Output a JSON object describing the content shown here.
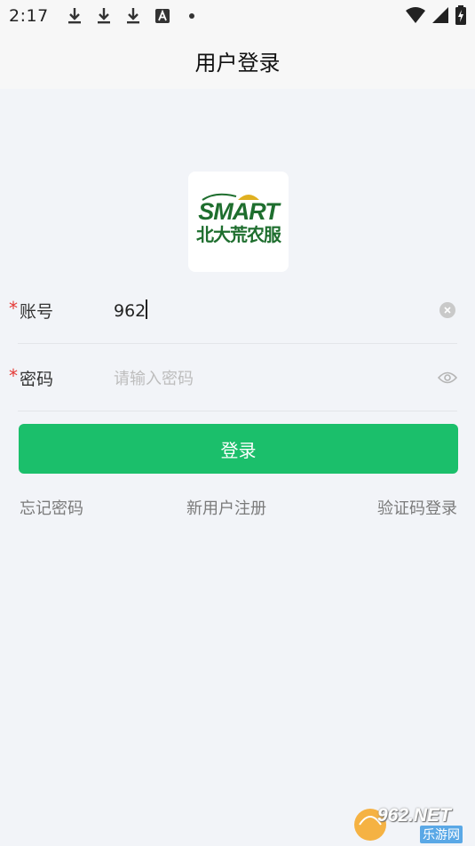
{
  "status_bar": {
    "time": "2:17"
  },
  "nav": {
    "title": "用户登录"
  },
  "logo": {
    "en": "SMART",
    "cn": "北大荒农服"
  },
  "account": {
    "required_mark": "*",
    "label": "账号",
    "value": "962"
  },
  "password": {
    "required_mark": "*",
    "label": "密码",
    "placeholder": "请输入密码"
  },
  "login_button": "登录",
  "links": {
    "forgot": "忘记密码",
    "register": "新用户注册",
    "sms_login": "验证码登录"
  },
  "watermark": {
    "brand": "962.NET",
    "sub": "乐游网"
  },
  "colors": {
    "primary": "#1bbf6b",
    "required": "#e53935",
    "background": "#f2f4f8",
    "logo_green": "#1e6e2e"
  }
}
